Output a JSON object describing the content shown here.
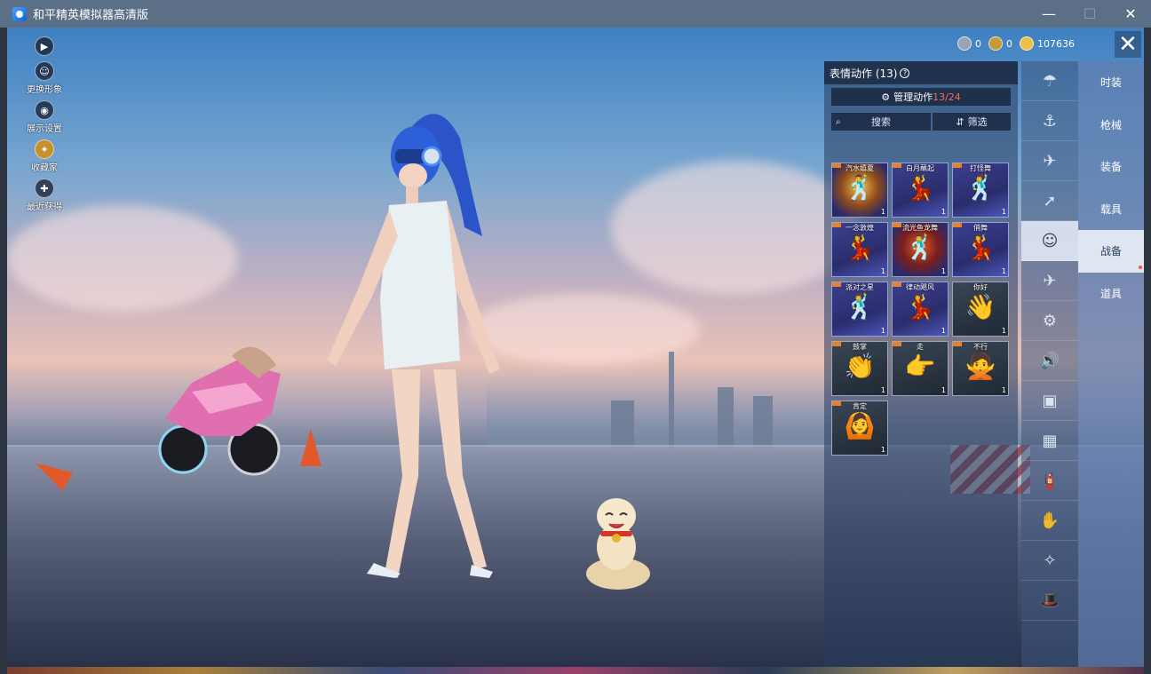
{
  "window": {
    "title": "和平精英模拟器高清版",
    "controls": [
      "—",
      "☐",
      "✕"
    ]
  },
  "left_toolbar": [
    {
      "icon": "play-icon",
      "glyph": "▶",
      "label": ""
    },
    {
      "icon": "avatar-icon",
      "glyph": "☺",
      "label": "更换形象"
    },
    {
      "icon": "eye-icon",
      "glyph": "◉",
      "label": "展示设置"
    },
    {
      "icon": "collection-icon",
      "glyph": "✦",
      "label": "收藏家"
    },
    {
      "icon": "gift-icon",
      "glyph": "✚",
      "label": "最近获得"
    }
  ],
  "currencies": [
    {
      "icon": "silver-coin-icon",
      "value": "0",
      "color": "#9aa3b5"
    },
    {
      "icon": "gold-badge-icon",
      "value": "0",
      "color": "#c49a3c"
    },
    {
      "icon": "gold-coin-icon",
      "value": "107636",
      "color": "#e8c04a"
    }
  ],
  "close_glyph": "✕",
  "panel": {
    "title": "表情动作 (13)",
    "help": "?",
    "manage_label": "管理动作",
    "manage_count": "13/24",
    "search_label": "搜索",
    "filter_label": "筛选",
    "emotes": [
      {
        "name": "汽水嬉夏",
        "count": "1",
        "style": "gold",
        "figure": "🕺"
      },
      {
        "name": "白月蘸起",
        "count": "1",
        "style": "purple",
        "figure": "💃"
      },
      {
        "name": "打怪舞",
        "count": "1",
        "style": "purple",
        "figure": "🕺"
      },
      {
        "name": "一念敦煌",
        "count": "1",
        "style": "purple",
        "figure": "💃"
      },
      {
        "name": "流光鱼龙舞",
        "count": "1",
        "style": "red",
        "figure": "🕺"
      },
      {
        "name": "俏舞",
        "count": "1",
        "style": "purple",
        "figure": "💃"
      },
      {
        "name": "派对之星",
        "count": "1",
        "style": "purple",
        "figure": "🕺"
      },
      {
        "name": "律动飓风",
        "count": "1",
        "style": "purple",
        "figure": "💃"
      },
      {
        "name": "你好",
        "count": "1",
        "style": "dark",
        "figure": "👋"
      },
      {
        "name": "鼓掌",
        "count": "1",
        "style": "dark",
        "figure": "👏"
      },
      {
        "name": "走",
        "count": "1",
        "style": "dark",
        "figure": "👉"
      },
      {
        "name": "不行",
        "count": "1",
        "style": "dark",
        "figure": "🙅"
      },
      {
        "name": "肯定",
        "count": "1",
        "style": "dark",
        "figure": "🙆"
      }
    ]
  },
  "icon_column": [
    {
      "icon": "parachute-icon",
      "glyph": "☂"
    },
    {
      "icon": "backpack-icon",
      "glyph": "⚓"
    },
    {
      "icon": "drone-icon",
      "glyph": "✈"
    },
    {
      "icon": "glider-icon",
      "glyph": "➚"
    },
    {
      "icon": "emote-face-icon",
      "glyph": "☺"
    },
    {
      "icon": "plane-icon",
      "glyph": "✈"
    },
    {
      "icon": "robot-icon",
      "glyph": "⚙"
    },
    {
      "icon": "speaker-icon",
      "glyph": "🔊"
    },
    {
      "icon": "sticker-icon",
      "glyph": "▣"
    },
    {
      "icon": "photo-icon",
      "glyph": "▦"
    },
    {
      "icon": "extinguisher-icon",
      "glyph": "🧯"
    },
    {
      "icon": "hand-icon",
      "glyph": "✋"
    },
    {
      "icon": "wand-icon",
      "glyph": "✧"
    },
    {
      "icon": "hat-icon",
      "glyph": "🎩"
    }
  ],
  "categories": [
    {
      "label": "时装",
      "active": false,
      "dot": false
    },
    {
      "label": "枪械",
      "active": false,
      "dot": false
    },
    {
      "label": "装备",
      "active": false,
      "dot": false
    },
    {
      "label": "载具",
      "active": false,
      "dot": false
    },
    {
      "label": "战备",
      "active": true,
      "dot": true
    },
    {
      "label": "道具",
      "active": false,
      "dot": false
    }
  ]
}
